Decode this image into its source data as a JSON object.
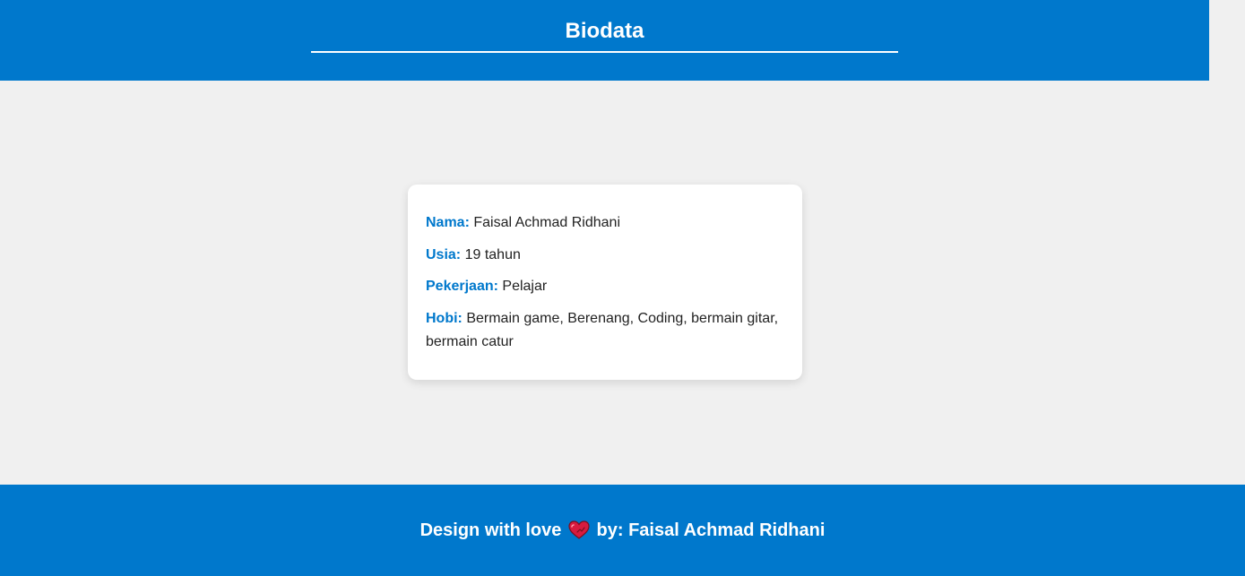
{
  "header": {
    "title": "Biodata"
  },
  "profile": {
    "fields": [
      {
        "label": "Nama:",
        "value": "Faisal Achmad Ridhani"
      },
      {
        "label": "Usia:",
        "value": "19 tahun"
      },
      {
        "label": "Pekerjaan:",
        "value": "Pelajar"
      },
      {
        "label": "Hobi:",
        "value": "Bermain game, Berenang, Coding, bermain gitar, bermain catur"
      }
    ]
  },
  "footer": {
    "text_before_icon": "Design with love",
    "icon": "heart-icon",
    "text_after_icon": "by: Faisal Achmad Ridhani"
  },
  "colors": {
    "accent": "#0078cc",
    "background": "#f0f0f0",
    "card": "#ffffff",
    "heart": "#d81b3f"
  }
}
